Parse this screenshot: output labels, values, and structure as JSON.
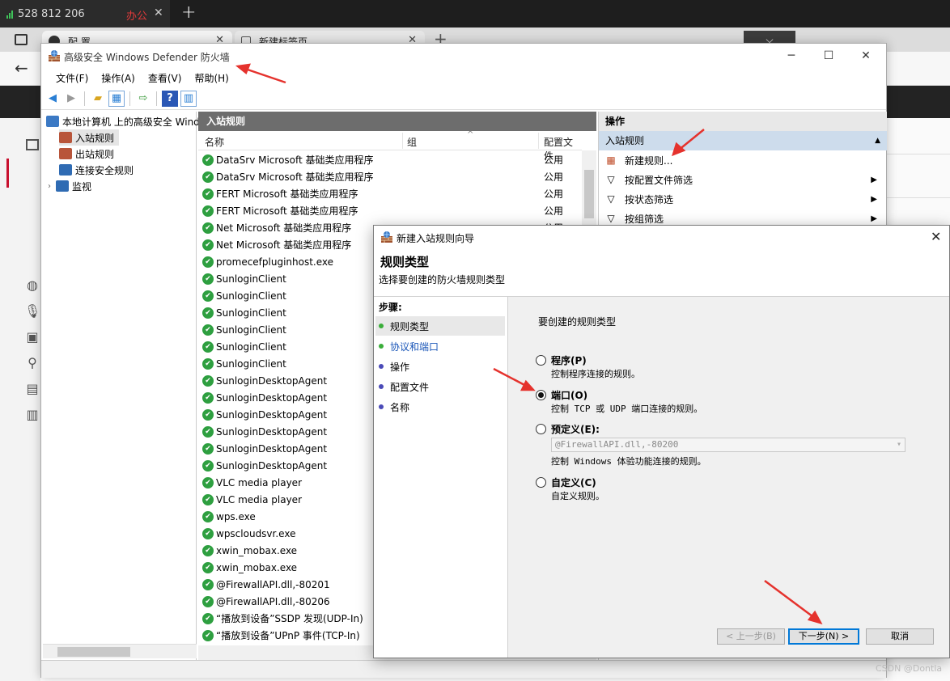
{
  "browser": {
    "tab1": {
      "number": "528 812 206",
      "group": "办公"
    },
    "tab2a_label": "配 置",
    "tab2b_label": "新建标签页",
    "dropdown_glyph": "⌵"
  },
  "mmc": {
    "title": "高级安全 Windows Defender 防火墙",
    "menus": [
      "文件(F)",
      "操作(A)",
      "查看(V)",
      "帮助(H)"
    ],
    "tree": {
      "root": "本地计算机 上的高级安全 Wind",
      "items": [
        "入站规则",
        "出站规则",
        "连接安全规则",
        "监视"
      ]
    },
    "list": {
      "header": "入站规则",
      "columns": [
        "名称",
        "组",
        "配置文件"
      ],
      "rows": [
        {
          "name": "DataSrv Microsoft 基础类应用程序",
          "profile": "公用"
        },
        {
          "name": "DataSrv Microsoft 基础类应用程序",
          "profile": "公用"
        },
        {
          "name": "FERT Microsoft 基础类应用程序",
          "profile": "公用"
        },
        {
          "name": "FERT Microsoft 基础类应用程序",
          "profile": "公用"
        },
        {
          "name": "Net Microsoft 基础类应用程序",
          "profile": "公用"
        },
        {
          "name": "Net Microsoft 基础类应用程序",
          "profile": ""
        },
        {
          "name": "promecefpluginhost.exe",
          "profile": ""
        },
        {
          "name": "SunloginClient",
          "profile": ""
        },
        {
          "name": "SunloginClient",
          "profile": ""
        },
        {
          "name": "SunloginClient",
          "profile": ""
        },
        {
          "name": "SunloginClient",
          "profile": ""
        },
        {
          "name": "SunloginClient",
          "profile": ""
        },
        {
          "name": "SunloginClient",
          "profile": ""
        },
        {
          "name": "SunloginDesktopAgent",
          "profile": ""
        },
        {
          "name": "SunloginDesktopAgent",
          "profile": ""
        },
        {
          "name": "SunloginDesktopAgent",
          "profile": ""
        },
        {
          "name": "SunloginDesktopAgent",
          "profile": ""
        },
        {
          "name": "SunloginDesktopAgent",
          "profile": ""
        },
        {
          "name": "SunloginDesktopAgent",
          "profile": ""
        },
        {
          "name": "VLC media player",
          "profile": ""
        },
        {
          "name": "VLC media player",
          "profile": ""
        },
        {
          "name": "wps.exe",
          "profile": ""
        },
        {
          "name": "wpscloudsvr.exe",
          "profile": ""
        },
        {
          "name": "xwin_mobax.exe",
          "profile": ""
        },
        {
          "name": "xwin_mobax.exe",
          "profile": ""
        },
        {
          "name": "@FirewallAPI.dll,-80201",
          "profile": ""
        },
        {
          "name": "@FirewallAPI.dll,-80206",
          "profile": ""
        },
        {
          "name": "“播放到设备”SSDP 发现(UDP-In)",
          "profile": ""
        },
        {
          "name": "“播放到设备”UPnP 事件(TCP-In)",
          "profile": ""
        }
      ]
    },
    "actions": {
      "header": "操作",
      "section": "入站规则",
      "items": [
        "新建规则...",
        "按配置文件筛选",
        "按状态筛选",
        "按组筛选"
      ]
    }
  },
  "wizard": {
    "title": "新建入站规则向导",
    "heading": "规则类型",
    "subheading": "选择要创建的防火墙规则类型",
    "steps_label": "步骤:",
    "steps": [
      "规则类型",
      "协议和端口",
      "操作",
      "配置文件",
      "名称"
    ],
    "prompt": "要创建的规则类型",
    "options": [
      {
        "label": "程序(P)",
        "desc": "控制程序连接的规则。",
        "selected": false
      },
      {
        "label": "端口(O)",
        "desc": "控制 TCP 或 UDP 端口连接的规则。",
        "selected": true
      },
      {
        "label": "预定义(E):",
        "desc": "控制 Windows 体验功能连接的规则。",
        "selected": false
      },
      {
        "label": "自定义(C)",
        "desc": "自定义规则。",
        "selected": false
      }
    ],
    "predefined_value": "@FirewallAPI.dll,-80200",
    "buttons": {
      "back": "< 上一步(B)",
      "next": "下一步(N) >",
      "cancel": "取消"
    }
  },
  "watermark": "CSDN @Dontla",
  "colors": {
    "accent": "#0078d7",
    "arrow": "#e5322d",
    "check": "#2e9f40"
  }
}
